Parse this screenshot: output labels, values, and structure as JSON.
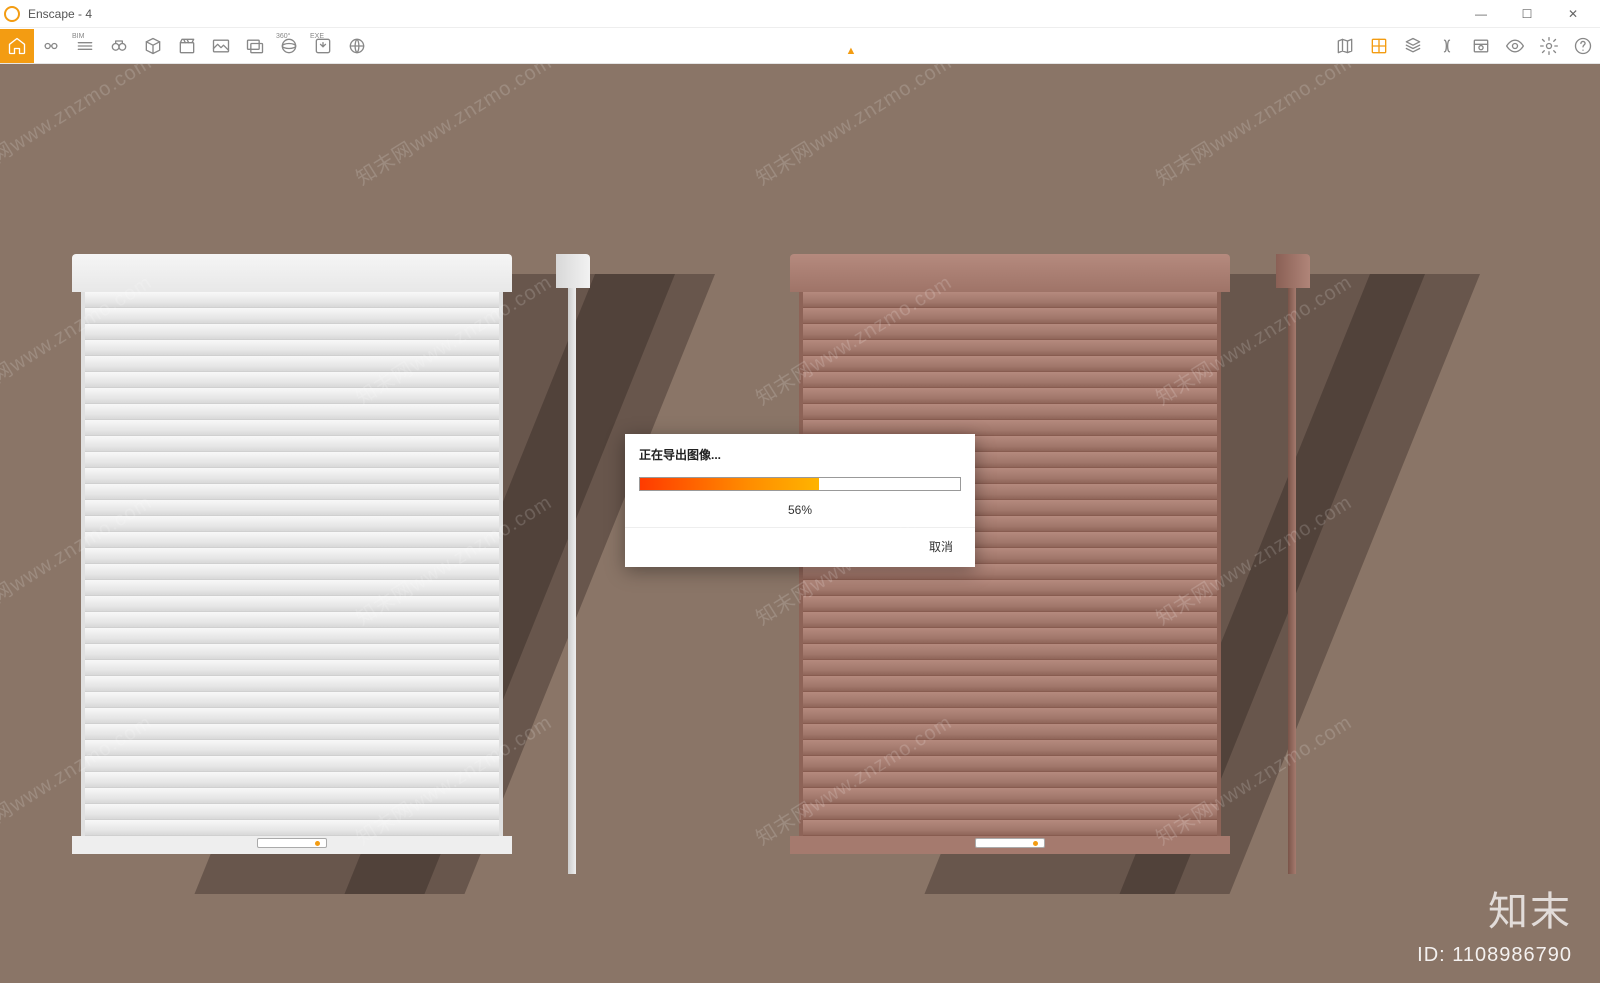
{
  "window": {
    "title": "Enscape - 4",
    "controls": {
      "minimize": "—",
      "maximize": "☐",
      "close": "✕"
    }
  },
  "toolbar": {
    "left": [
      {
        "name": "home-icon",
        "title": "home",
        "active": true
      },
      {
        "name": "link-icon",
        "title": "link"
      },
      {
        "name": "bim-icon",
        "title": "BIM",
        "badge": "BIM"
      },
      {
        "name": "binoculars-icon",
        "title": "views"
      },
      {
        "name": "box-icon",
        "title": "perspective"
      },
      {
        "name": "clapperboard-icon",
        "title": "video"
      },
      {
        "name": "screenshot-icon",
        "title": "screenshot"
      },
      {
        "name": "batch-render-icon",
        "title": "batch-render"
      },
      {
        "name": "panorama-icon",
        "title": "360",
        "badge": "360°"
      },
      {
        "name": "exe-export-icon",
        "title": "exe",
        "badge": "EXE"
      },
      {
        "name": "web-export-icon",
        "title": "web"
      }
    ],
    "right": [
      {
        "name": "map-icon",
        "title": "map"
      },
      {
        "name": "materials-icon",
        "title": "materials",
        "highlight": true
      },
      {
        "name": "assetlib-icon",
        "title": "asset-library"
      },
      {
        "name": "sound-icon",
        "title": "sound"
      },
      {
        "name": "sun-icon",
        "title": "sun"
      },
      {
        "name": "visibility-icon",
        "title": "visibility"
      },
      {
        "name": "settings-gear-icon",
        "title": "settings"
      },
      {
        "name": "help-icon",
        "title": "help"
      }
    ],
    "collapse_glyph": "▲"
  },
  "dialog": {
    "title": "正在导出图像...",
    "percent_text": "56%",
    "percent_value": 56,
    "cancel_label": "取消"
  },
  "watermark": {
    "repeat_text": "知末网www.znzmo.com",
    "logo_text": "知末",
    "id_label": "ID: 1108986790"
  },
  "colors": {
    "accent": "#f39c12",
    "bg": "#8a7567"
  }
}
